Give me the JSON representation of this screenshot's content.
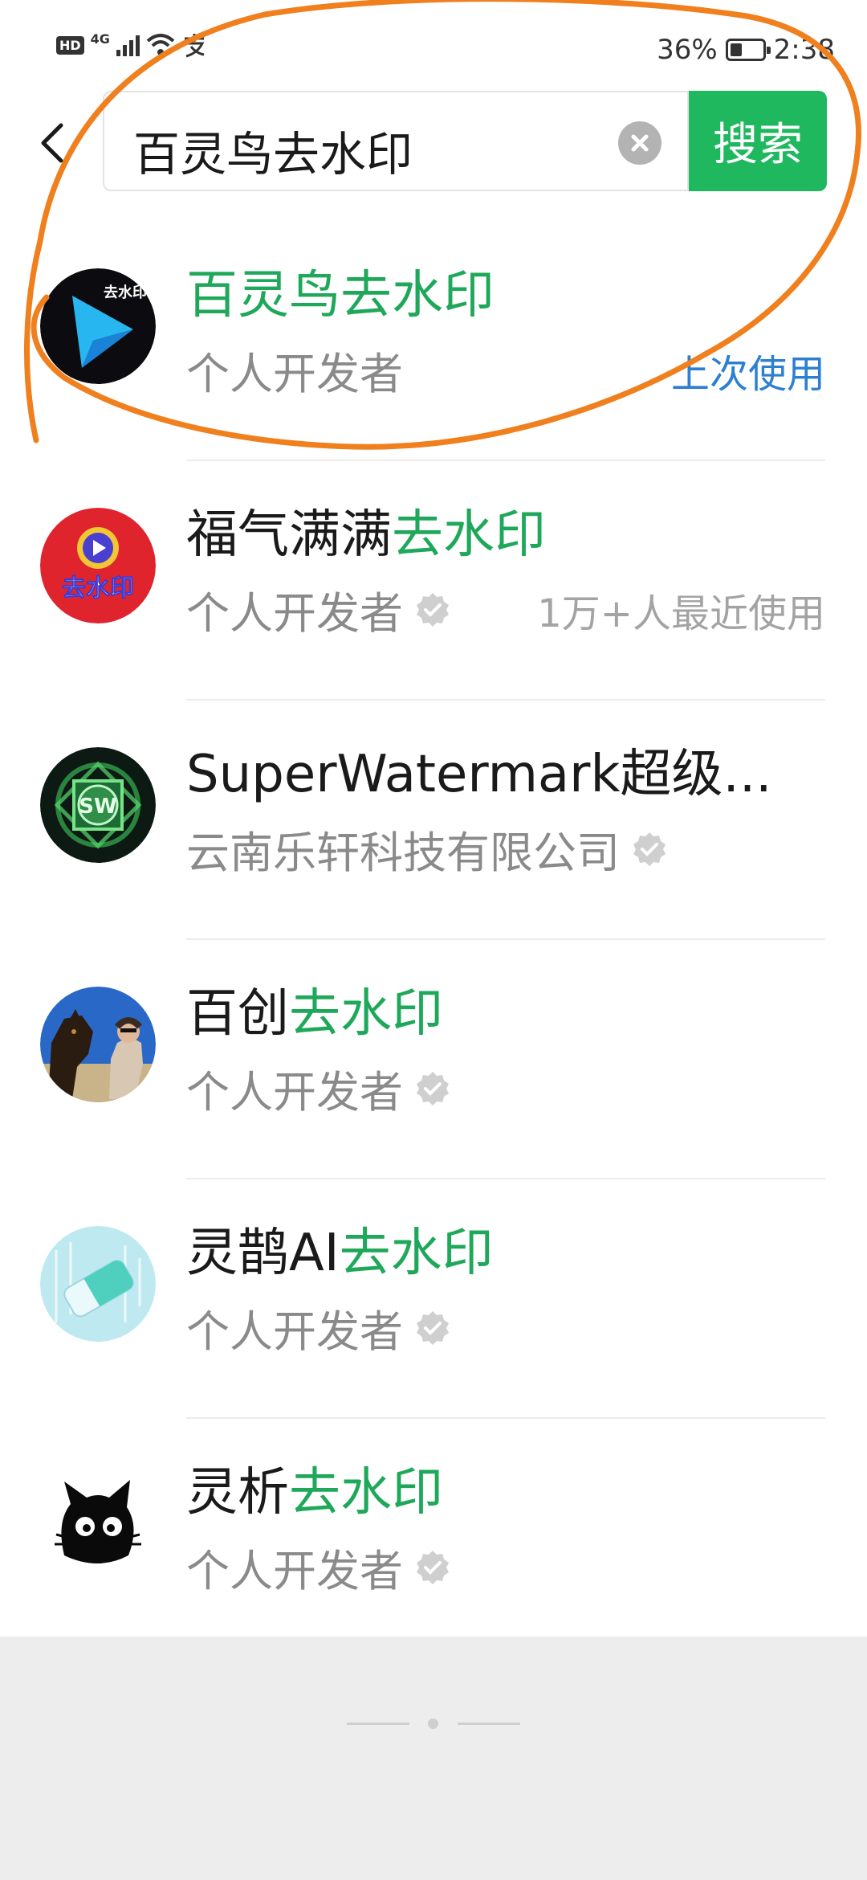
{
  "status_bar": {
    "hd": "HD",
    "network": "4G",
    "battery": "36%",
    "battery_level": 0.36,
    "time": "2:38"
  },
  "search": {
    "query": "百灵鸟去水印",
    "button_label": "搜索"
  },
  "results": [
    {
      "title_plain": "",
      "title_highlight": "百灵鸟去水印",
      "developer": "个人开发者",
      "verified": false,
      "right_text": "上次使用",
      "right_color": "#2c7fd1",
      "avatar_icon": "blue-swift-logo-icon"
    },
    {
      "title_plain": "福气满满",
      "title_highlight": "去水印",
      "developer": "个人开发者",
      "verified": true,
      "right_text": "1万+人最近使用",
      "right_color": "#a3a3a3",
      "avatar_icon": "red-play-logo-icon"
    },
    {
      "title_plain": "SuperWatermark超级...",
      "title_highlight": "",
      "developer": "云南乐轩科技有限公司",
      "verified": true,
      "right_text": "",
      "avatar_icon": "green-sw-logo-icon"
    },
    {
      "title_plain": "百创",
      "title_highlight": "去水印",
      "developer": "个人开发者",
      "verified": true,
      "right_text": "",
      "avatar_icon": "dog-photo-avatar-icon"
    },
    {
      "title_plain": "灵鹊AI",
      "title_highlight": "去水印",
      "developer": "个人开发者",
      "verified": true,
      "right_text": "",
      "avatar_icon": "eraser-logo-icon"
    },
    {
      "title_plain": "灵析",
      "title_highlight": "去水印",
      "developer": "个人开发者",
      "verified": true,
      "right_text": "",
      "avatar_icon": "black-cat-logo-icon"
    }
  ],
  "colors": {
    "accent_green": "#1fb85f",
    "highlight_green": "#1fa85a",
    "link_blue": "#2c7fd1",
    "annotation_orange": "#f07f1d"
  }
}
